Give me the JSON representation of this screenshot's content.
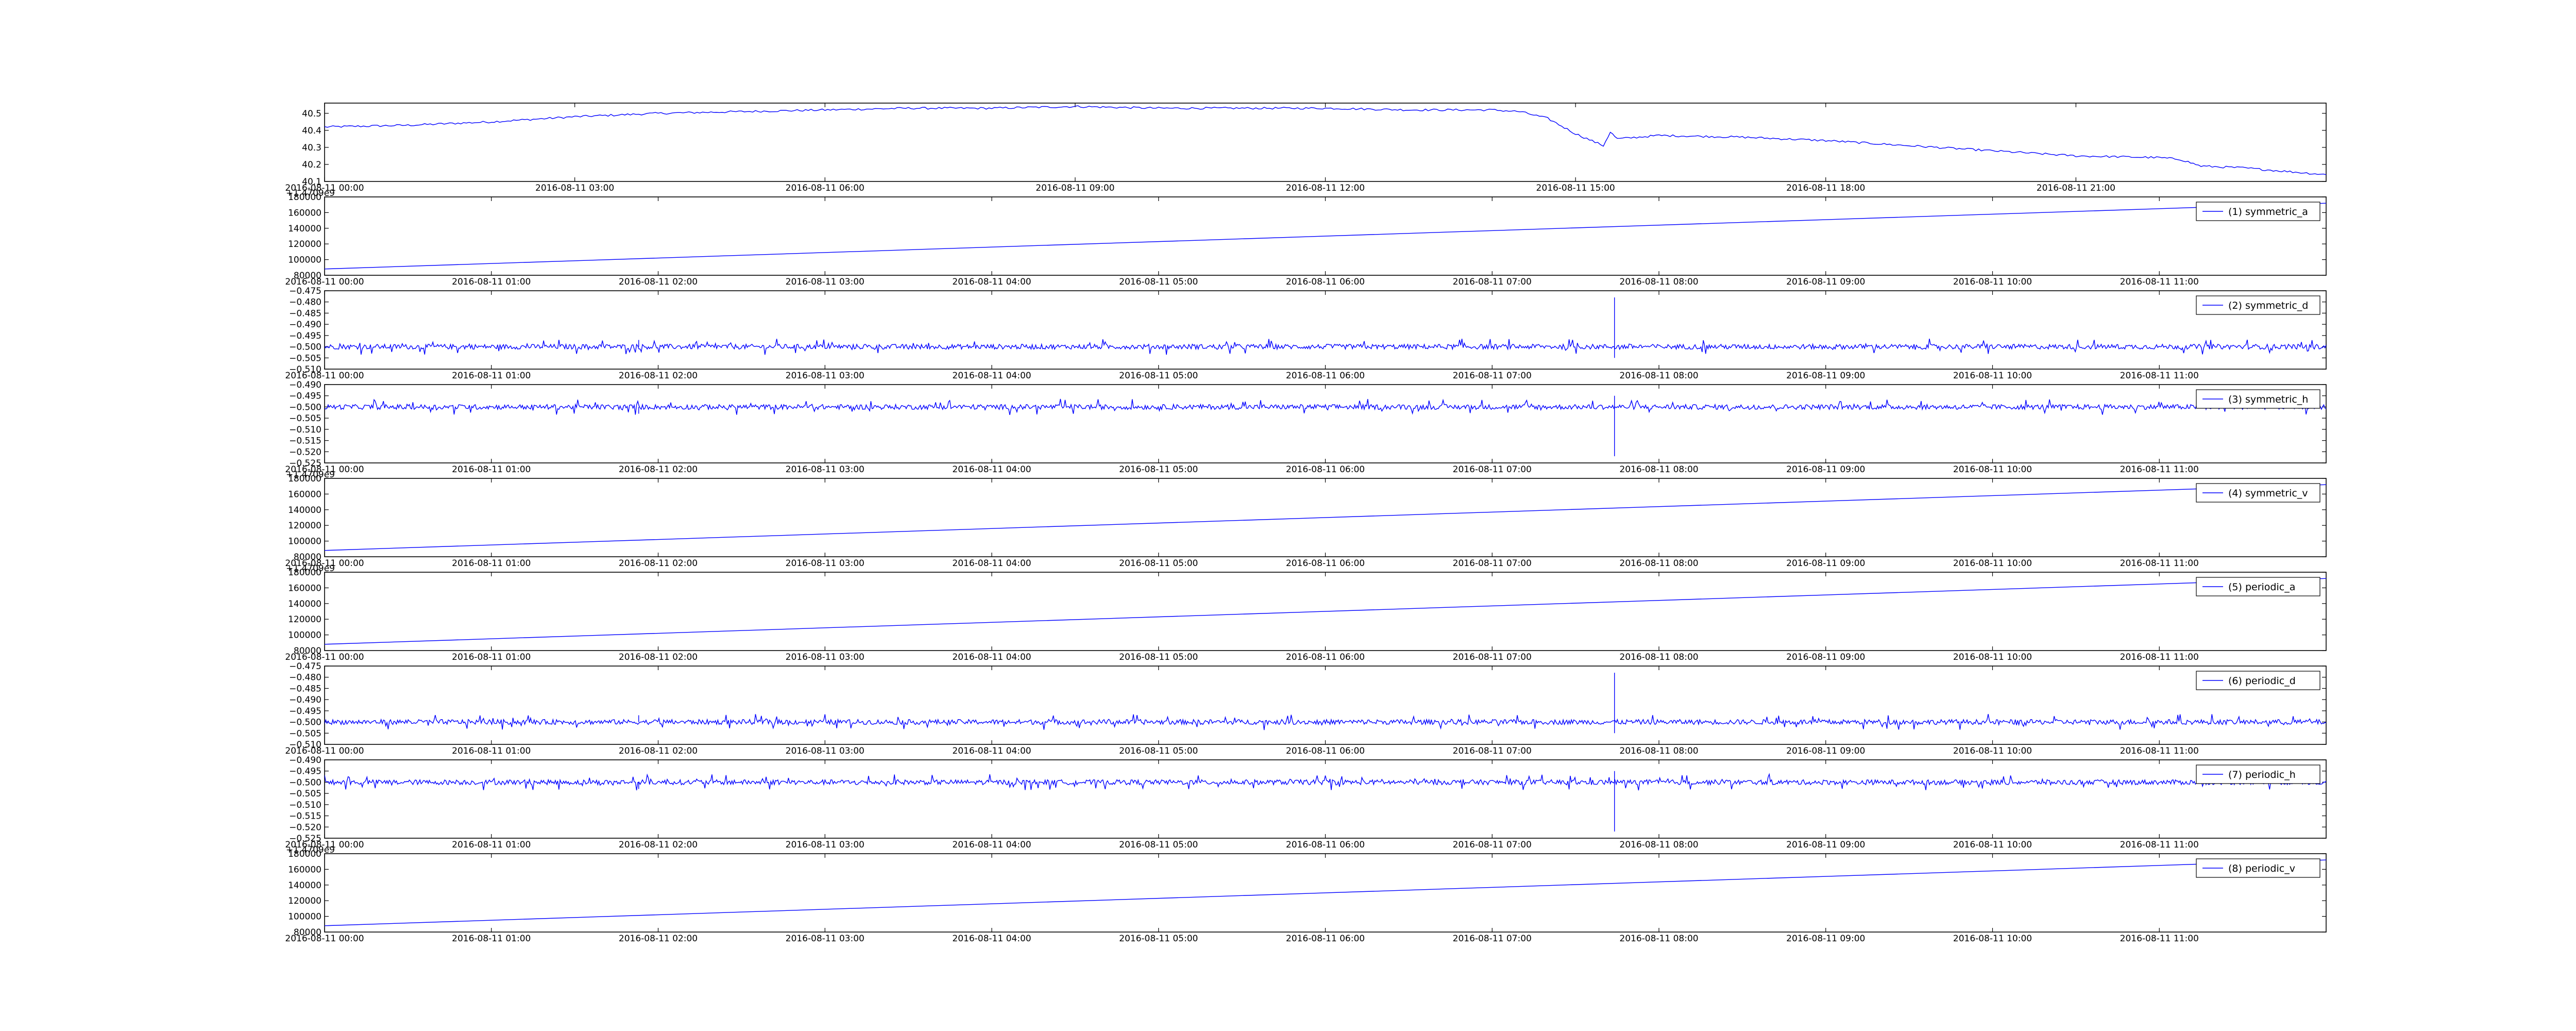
{
  "chart_data": [
    {
      "type": "line",
      "title": "",
      "xlabel": "",
      "ylabel": "",
      "x_is_time": true,
      "xlim": [
        "2016-08-11 00:00",
        "2016-08-11 23:59"
      ],
      "ylim": [
        40.1,
        40.56
      ],
      "yticks": [
        40.1,
        40.2,
        40.3,
        40.4,
        40.5
      ],
      "ytick_labels": [
        "40.1",
        "40.2",
        "40.3",
        "40.4",
        "40.5"
      ],
      "xtick_labels": [
        "2016-08-11 00:00",
        "2016-08-11 03:00",
        "2016-08-11 06:00",
        "2016-08-11 09:00",
        "2016-08-11 12:00",
        "2016-08-11 15:00",
        "2016-08-11 18:00",
        "2016-08-11 21:00"
      ],
      "series": [
        {
          "color": "#0000ff",
          "x": [
            "2016-08-11 00:00",
            "2016-08-11 01:00",
            "2016-08-11 02:00",
            "2016-08-11 03:00",
            "2016-08-11 04:00",
            "2016-08-11 05:00",
            "2016-08-11 06:00",
            "2016-08-11 07:00",
            "2016-08-11 08:00",
            "2016-08-11 09:00",
            "2016-08-11 10:00",
            "2016-08-11 11:00",
            "2016-08-11 12:00",
            "2016-08-11 13:00",
            "2016-08-11 14:00",
            "2016-08-11 14:20",
            "2016-08-11 14:40",
            "2016-08-11 15:00",
            "2016-08-11 15:20",
            "2016-08-11 15:25",
            "2016-08-11 15:30",
            "2016-08-11 16:00",
            "2016-08-11 17:00",
            "2016-08-11 18:00",
            "2016-08-11 19:00",
            "2016-08-11 20:00",
            "2016-08-11 21:00",
            "2016-08-11 22:00",
            "2016-08-11 22:15",
            "2016-08-11 22:30",
            "2016-08-11 23:00",
            "2016-08-11 23:30",
            "2016-08-11 23:59"
          ],
          "y": [
            40.42,
            40.43,
            40.45,
            40.48,
            40.5,
            40.51,
            40.52,
            40.53,
            40.53,
            40.54,
            40.53,
            40.53,
            40.53,
            40.52,
            40.52,
            40.51,
            40.47,
            40.38,
            40.31,
            40.39,
            40.35,
            40.37,
            40.36,
            40.34,
            40.31,
            40.28,
            40.25,
            40.24,
            40.23,
            40.19,
            40.18,
            40.16,
            40.14
          ]
        }
      ]
    },
    {
      "type": "line",
      "title": "",
      "xlabel": "",
      "ylabel": "",
      "x_is_time": true,
      "xlim": [
        "2016-08-11 00:00",
        "2016-08-11 12:00"
      ],
      "ylim": [
        80000,
        180000
      ],
      "offset_text": "+1.4709e9",
      "yticks": [
        80000,
        100000,
        120000,
        140000,
        160000,
        180000
      ],
      "ytick_labels": [
        "80000",
        "100000",
        "120000",
        "140000",
        "160000",
        "180000"
      ],
      "xtick_labels": [
        "2016-08-11 00:00",
        "2016-08-11 01:00",
        "2016-08-11 02:00",
        "2016-08-11 03:00",
        "2016-08-11 04:00",
        "2016-08-11 05:00",
        "2016-08-11 06:00",
        "2016-08-11 07:00",
        "2016-08-11 08:00",
        "2016-08-11 09:00",
        "2016-08-11 10:00",
        "2016-08-11 11:00"
      ],
      "legend_placement": "top-right",
      "series": [
        {
          "name": "(1) symmetric_a",
          "color": "#0000ff",
          "x": [
            "2016-08-11 00:00",
            "2016-08-11 12:00"
          ],
          "y": [
            88000,
            172000
          ]
        }
      ]
    },
    {
      "type": "line",
      "title": "",
      "xlabel": "",
      "ylabel": "",
      "x_is_time": true,
      "xlim": [
        "2016-08-11 00:00",
        "2016-08-11 12:00"
      ],
      "ylim": [
        -0.51,
        -0.475
      ],
      "yticks": [
        -0.51,
        -0.505,
        -0.5,
        -0.495,
        -0.49,
        -0.485,
        -0.48,
        -0.475
      ],
      "ytick_labels": [
        "−0.510",
        "−0.505",
        "−0.500",
        "−0.495",
        "−0.490",
        "−0.485",
        "−0.480",
        "−0.475"
      ],
      "xtick_labels": [
        "2016-08-11 00:00",
        "2016-08-11 01:00",
        "2016-08-11 02:00",
        "2016-08-11 03:00",
        "2016-08-11 04:00",
        "2016-08-11 05:00",
        "2016-08-11 06:00",
        "2016-08-11 07:00",
        "2016-08-11 08:00",
        "2016-08-11 09:00",
        "2016-08-11 10:00",
        "2016-08-11 11:00"
      ],
      "legend_placement": "top-right",
      "series": [
        {
          "name": "(2) symmetric_d",
          "color": "#0000ff",
          "baseline": -0.5,
          "noise_amplitude": 0.004,
          "spikes": [
            {
              "x": "2016-08-11 07:44",
              "y": -0.478
            },
            {
              "x": "2016-08-11 07:44",
              "y": -0.505
            },
            {
              "x": "2016-08-11 01:53",
              "y": -0.497
            }
          ]
        }
      ]
    },
    {
      "type": "line",
      "title": "",
      "xlabel": "",
      "ylabel": "",
      "x_is_time": true,
      "xlim": [
        "2016-08-11 00:00",
        "2016-08-11 12:00"
      ],
      "ylim": [
        -0.525,
        -0.49
      ],
      "yticks": [
        -0.525,
        -0.52,
        -0.515,
        -0.51,
        -0.505,
        -0.5,
        -0.495,
        -0.49
      ],
      "ytick_labels": [
        "−0.525",
        "−0.520",
        "−0.515",
        "−0.510",
        "−0.505",
        "−0.500",
        "−0.495",
        "−0.490"
      ],
      "xtick_labels": [
        "2016-08-11 00:00",
        "2016-08-11 01:00",
        "2016-08-11 02:00",
        "2016-08-11 03:00",
        "2016-08-11 04:00",
        "2016-08-11 05:00",
        "2016-08-11 06:00",
        "2016-08-11 07:00",
        "2016-08-11 08:00",
        "2016-08-11 09:00",
        "2016-08-11 10:00",
        "2016-08-11 11:00"
      ],
      "legend_placement": "top-right",
      "series": [
        {
          "name": "(3) symmetric_h",
          "color": "#0000ff",
          "baseline": -0.5,
          "noise_amplitude": 0.004,
          "spikes": [
            {
              "x": "2016-08-11 07:44",
              "y": -0.522
            },
            {
              "x": "2016-08-11 07:44",
              "y": -0.495
            },
            {
              "x": "2016-08-11 01:53",
              "y": -0.503
            }
          ]
        }
      ]
    },
    {
      "type": "line",
      "title": "",
      "xlabel": "",
      "ylabel": "",
      "x_is_time": true,
      "xlim": [
        "2016-08-11 00:00",
        "2016-08-11 12:00"
      ],
      "ylim": [
        80000,
        180000
      ],
      "offset_text": "+1.4709e9",
      "yticks": [
        80000,
        100000,
        120000,
        140000,
        160000,
        180000
      ],
      "ytick_labels": [
        "80000",
        "100000",
        "120000",
        "140000",
        "160000",
        "180000"
      ],
      "xtick_labels": [
        "2016-08-11 00:00",
        "2016-08-11 01:00",
        "2016-08-11 02:00",
        "2016-08-11 03:00",
        "2016-08-11 04:00",
        "2016-08-11 05:00",
        "2016-08-11 06:00",
        "2016-08-11 07:00",
        "2016-08-11 08:00",
        "2016-08-11 09:00",
        "2016-08-11 10:00",
        "2016-08-11 11:00"
      ],
      "legend_placement": "top-right",
      "series": [
        {
          "name": "(4) symmetric_v",
          "color": "#0000ff",
          "x": [
            "2016-08-11 00:00",
            "2016-08-11 12:00"
          ],
          "y": [
            88000,
            172000
          ]
        }
      ]
    },
    {
      "type": "line",
      "title": "",
      "xlabel": "",
      "ylabel": "",
      "x_is_time": true,
      "xlim": [
        "2016-08-11 00:00",
        "2016-08-11 12:00"
      ],
      "ylim": [
        80000,
        180000
      ],
      "offset_text": "+1.4709e9",
      "yticks": [
        80000,
        100000,
        120000,
        140000,
        160000,
        180000
      ],
      "ytick_labels": [
        "80000",
        "100000",
        "120000",
        "140000",
        "160000",
        "180000"
      ],
      "xtick_labels": [
        "2016-08-11 00:00",
        "2016-08-11 01:00",
        "2016-08-11 02:00",
        "2016-08-11 03:00",
        "2016-08-11 04:00",
        "2016-08-11 05:00",
        "2016-08-11 06:00",
        "2016-08-11 07:00",
        "2016-08-11 08:00",
        "2016-08-11 09:00",
        "2016-08-11 10:00",
        "2016-08-11 11:00"
      ],
      "legend_placement": "top-right",
      "series": [
        {
          "name": "(5) periodic_a",
          "color": "#0000ff",
          "x": [
            "2016-08-11 00:00",
            "2016-08-11 12:00"
          ],
          "y": [
            88000,
            172000
          ]
        }
      ]
    },
    {
      "type": "line",
      "title": "",
      "xlabel": "",
      "ylabel": "",
      "x_is_time": true,
      "xlim": [
        "2016-08-11 00:00",
        "2016-08-11 12:00"
      ],
      "ylim": [
        -0.51,
        -0.475
      ],
      "yticks": [
        -0.51,
        -0.505,
        -0.5,
        -0.495,
        -0.49,
        -0.485,
        -0.48,
        -0.475
      ],
      "ytick_labels": [
        "−0.510",
        "−0.505",
        "−0.500",
        "−0.495",
        "−0.490",
        "−0.485",
        "−0.480",
        "−0.475"
      ],
      "xtick_labels": [
        "2016-08-11 00:00",
        "2016-08-11 01:00",
        "2016-08-11 02:00",
        "2016-08-11 03:00",
        "2016-08-11 04:00",
        "2016-08-11 05:00",
        "2016-08-11 06:00",
        "2016-08-11 07:00",
        "2016-08-11 08:00",
        "2016-08-11 09:00",
        "2016-08-11 10:00",
        "2016-08-11 11:00"
      ],
      "legend_placement": "top-right",
      "series": [
        {
          "name": "(6) periodic_d",
          "color": "#0000ff",
          "baseline": -0.5,
          "noise_amplitude": 0.004,
          "spikes": [
            {
              "x": "2016-08-11 07:44",
              "y": -0.478
            },
            {
              "x": "2016-08-11 07:44",
              "y": -0.505
            },
            {
              "x": "2016-08-11 01:53",
              "y": -0.497
            }
          ]
        }
      ]
    },
    {
      "type": "line",
      "title": "",
      "xlabel": "",
      "ylabel": "",
      "x_is_time": true,
      "xlim": [
        "2016-08-11 00:00",
        "2016-08-11 12:00"
      ],
      "ylim": [
        -0.525,
        -0.49
      ],
      "yticks": [
        -0.525,
        -0.52,
        -0.515,
        -0.51,
        -0.505,
        -0.5,
        -0.495,
        -0.49
      ],
      "ytick_labels": [
        "−0.525",
        "−0.520",
        "−0.515",
        "−0.510",
        "−0.505",
        "−0.500",
        "−0.495",
        "−0.490"
      ],
      "xtick_labels": [
        "2016-08-11 00:00",
        "2016-08-11 01:00",
        "2016-08-11 02:00",
        "2016-08-11 03:00",
        "2016-08-11 04:00",
        "2016-08-11 05:00",
        "2016-08-11 06:00",
        "2016-08-11 07:00",
        "2016-08-11 08:00",
        "2016-08-11 09:00",
        "2016-08-11 10:00",
        "2016-08-11 11:00"
      ],
      "legend_placement": "top-right",
      "series": [
        {
          "name": "(7) periodic_h",
          "color": "#0000ff",
          "baseline": -0.5,
          "noise_amplitude": 0.004,
          "spikes": [
            {
              "x": "2016-08-11 07:44",
              "y": -0.522
            },
            {
              "x": "2016-08-11 07:44",
              "y": -0.495
            },
            {
              "x": "2016-08-11 01:53",
              "y": -0.503
            }
          ]
        }
      ]
    },
    {
      "type": "line",
      "title": "",
      "xlabel": "",
      "ylabel": "",
      "x_is_time": true,
      "xlim": [
        "2016-08-11 00:00",
        "2016-08-11 12:00"
      ],
      "ylim": [
        80000,
        180000
      ],
      "offset_text": "+1.4709e9",
      "yticks": [
        80000,
        100000,
        120000,
        140000,
        160000,
        180000
      ],
      "ytick_labels": [
        "80000",
        "100000",
        "120000",
        "140000",
        "160000",
        "180000"
      ],
      "xtick_labels": [
        "2016-08-11 00:00",
        "2016-08-11 01:00",
        "2016-08-11 02:00",
        "2016-08-11 03:00",
        "2016-08-11 04:00",
        "2016-08-11 05:00",
        "2016-08-11 06:00",
        "2016-08-11 07:00",
        "2016-08-11 08:00",
        "2016-08-11 09:00",
        "2016-08-11 10:00",
        "2016-08-11 11:00"
      ],
      "legend_placement": "top-right",
      "series": [
        {
          "name": "(8) periodic_v",
          "color": "#0000ff",
          "x": [
            "2016-08-11 00:00",
            "2016-08-11 12:00"
          ],
          "y": [
            88000,
            172000
          ]
        }
      ]
    }
  ]
}
